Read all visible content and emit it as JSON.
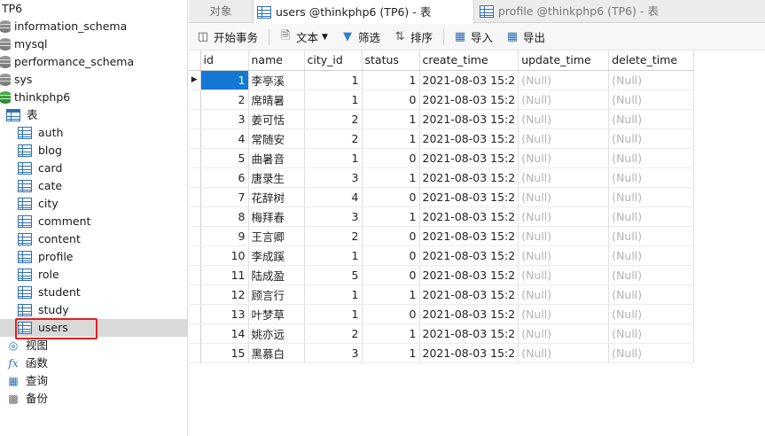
{
  "tree": {
    "connection": "TP6",
    "databases": [
      {
        "label": "information_schema"
      },
      {
        "label": "mysql"
      },
      {
        "label": "performance_schema"
      },
      {
        "label": "sys"
      },
      {
        "label": "thinkphp6"
      }
    ],
    "tables_group": "表",
    "tables": [
      "auth",
      "blog",
      "card",
      "cate",
      "city",
      "comment",
      "content",
      "profile",
      "role",
      "student",
      "study",
      "users"
    ],
    "other_groups": [
      "视图",
      "函数",
      "查询",
      "备份"
    ]
  },
  "tabs": [
    {
      "label": "对象"
    },
    {
      "label": "users @thinkphp6 (TP6) - 表"
    },
    {
      "label": "profile @thinkphp6 (TP6) - 表"
    }
  ],
  "toolbar": {
    "begin_tx": "开始事务",
    "text": "文本",
    "filter": "筛选",
    "sort": "排序",
    "import": "导入",
    "export": "导出"
  },
  "grid": {
    "columns": [
      "id",
      "name",
      "city_id",
      "status",
      "create_time",
      "update_time",
      "delete_time"
    ],
    "rows": [
      {
        "id": "1",
        "name": "李亭溪",
        "city_id": "1",
        "status": "1",
        "create_time": "2021-08-03 15:2",
        "update_time": "(Null)",
        "delete_time": "(Null)"
      },
      {
        "id": "2",
        "name": "席晴暑",
        "city_id": "1",
        "status": "0",
        "create_time": "2021-08-03 15:2",
        "update_time": "(Null)",
        "delete_time": "(Null)"
      },
      {
        "id": "3",
        "name": "姜可恬",
        "city_id": "2",
        "status": "1",
        "create_time": "2021-08-03 15:2",
        "update_time": "(Null)",
        "delete_time": "(Null)"
      },
      {
        "id": "4",
        "name": "常随安",
        "city_id": "2",
        "status": "1",
        "create_time": "2021-08-03 15:2",
        "update_time": "(Null)",
        "delete_time": "(Null)"
      },
      {
        "id": "5",
        "name": "曲暑音",
        "city_id": "1",
        "status": "0",
        "create_time": "2021-08-03 15:2",
        "update_time": "(Null)",
        "delete_time": "(Null)"
      },
      {
        "id": "6",
        "name": "唐录生",
        "city_id": "3",
        "status": "1",
        "create_time": "2021-08-03 15:2",
        "update_time": "(Null)",
        "delete_time": "(Null)"
      },
      {
        "id": "7",
        "name": "花辞树",
        "city_id": "4",
        "status": "0",
        "create_time": "2021-08-03 15:2",
        "update_time": "(Null)",
        "delete_time": "(Null)"
      },
      {
        "id": "8",
        "name": "梅拜春",
        "city_id": "3",
        "status": "1",
        "create_time": "2021-08-03 15:2",
        "update_time": "(Null)",
        "delete_time": "(Null)"
      },
      {
        "id": "9",
        "name": "王言卿",
        "city_id": "2",
        "status": "0",
        "create_time": "2021-08-03 15:2",
        "update_time": "(Null)",
        "delete_time": "(Null)"
      },
      {
        "id": "10",
        "name": "李成蹊",
        "city_id": "1",
        "status": "0",
        "create_time": "2021-08-03 15:2",
        "update_time": "(Null)",
        "delete_time": "(Null)"
      },
      {
        "id": "11",
        "name": "陆成盈",
        "city_id": "5",
        "status": "0",
        "create_time": "2021-08-03 15:2",
        "update_time": "(Null)",
        "delete_time": "(Null)"
      },
      {
        "id": "12",
        "name": "顾言行",
        "city_id": "1",
        "status": "1",
        "create_time": "2021-08-03 15:2",
        "update_time": "(Null)",
        "delete_time": "(Null)"
      },
      {
        "id": "13",
        "name": "叶梦草",
        "city_id": "1",
        "status": "0",
        "create_time": "2021-08-03 15:2",
        "update_time": "(Null)",
        "delete_time": "(Null)"
      },
      {
        "id": "14",
        "name": "姚亦远",
        "city_id": "2",
        "status": "1",
        "create_time": "2021-08-03 15:2",
        "update_time": "(Null)",
        "delete_time": "(Null)"
      },
      {
        "id": "15",
        "name": "黑慕白",
        "city_id": "3",
        "status": "1",
        "create_time": "2021-08-03 15:2",
        "update_time": "(Null)",
        "delete_time": "(Null)"
      }
    ]
  },
  "colors": {
    "selection": "#1478d4",
    "highlight_box": "#e02020",
    "null_text": "#b3b3b3"
  }
}
